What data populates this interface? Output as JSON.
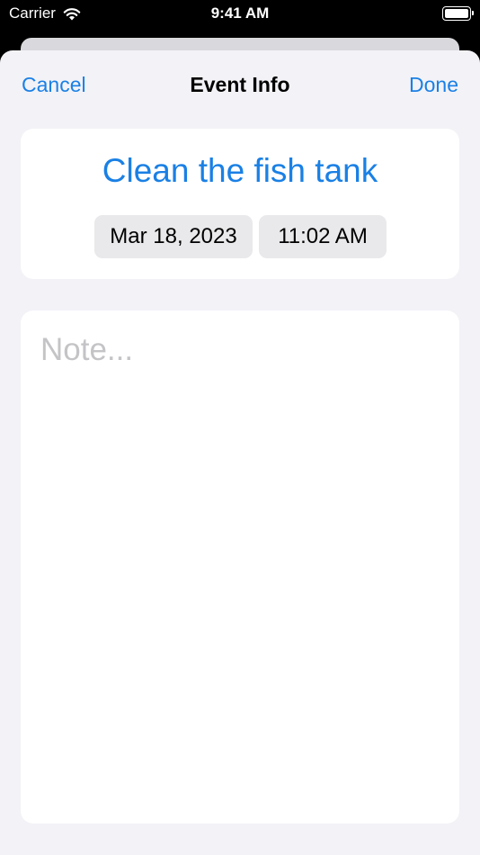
{
  "status_bar": {
    "carrier": "Carrier",
    "time": "9:41 AM",
    "icons": [
      "wifi-icon",
      "battery-icon"
    ],
    "battery_level": 1.0
  },
  "nav": {
    "cancel_label": "Cancel",
    "title": "Event Info",
    "done_label": "Done"
  },
  "event": {
    "title": "Clean the fish tank",
    "date": "Mar 18, 2023",
    "time": "11:02 AM"
  },
  "note": {
    "value": "",
    "placeholder": "Note..."
  },
  "colors": {
    "accent": "#1a80e5",
    "sheet_background": "#f2f2f7",
    "card_background": "#ffffff",
    "pill_background": "#e9e9eb",
    "placeholder": "#c4c4c7"
  }
}
